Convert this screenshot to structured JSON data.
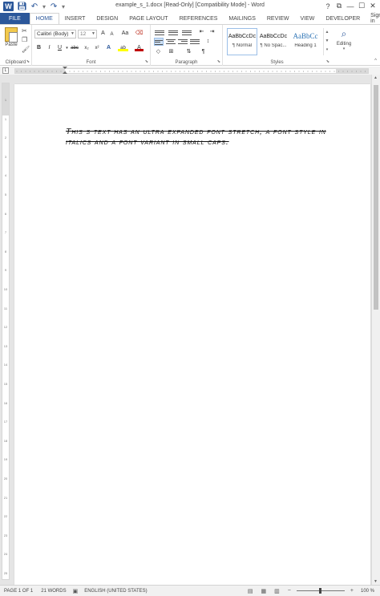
{
  "title": "example_s_1.docx [Read-Only] [Compatibility Mode] - Word",
  "qat": {
    "app_icon": "W",
    "icons": [
      "save-icon",
      "undo-icon",
      "redo-icon",
      "customize-icon"
    ]
  },
  "window_controls": [
    "?",
    "⧉",
    "—",
    "☐",
    "✕"
  ],
  "tabs": [
    "FILE",
    "HOME",
    "INSERT",
    "DESIGN",
    "PAGE LAYOUT",
    "REFERENCES",
    "MAILINGS",
    "REVIEW",
    "VIEW",
    "DEVELOPER"
  ],
  "active_tab": "HOME",
  "signin": "Sign in",
  "ribbon": {
    "clipboard": {
      "label": "Clipboard",
      "paste": "Paste"
    },
    "font": {
      "label": "Font",
      "name": "Calibri (Body)",
      "size": "12",
      "grow": "A",
      "shrink": "A",
      "case": "Aa",
      "bold": "B",
      "italic": "I",
      "underline": "U",
      "strike": "abc",
      "sub": "x₂",
      "sup": "x²",
      "effects": "A",
      "highlight": "ab",
      "color": "A"
    },
    "paragraph": {
      "label": "Paragraph",
      "pilcrow": "¶"
    },
    "styles": {
      "label": "Styles",
      "items": [
        {
          "preview": "AaBbCcDc",
          "name": "¶ Normal"
        },
        {
          "preview": "AaBbCcDc",
          "name": "¶ No Spac..."
        },
        {
          "preview": "AaBbCc",
          "name": "Heading 1"
        }
      ]
    },
    "editing": {
      "label": "Editing"
    }
  },
  "ruler": {
    "tab_selector": "L"
  },
  "vruler_ticks": [
    "1",
    "1",
    "2",
    "3",
    "4",
    "5",
    "6",
    "7",
    "8",
    "9",
    "10",
    "11",
    "12",
    "13",
    "14",
    "15",
    "16",
    "17",
    "18",
    "19",
    "20",
    "21",
    "22",
    "23",
    "24",
    "25"
  ],
  "document": {
    "text": "This s text has an ultra expanded font stretch, a font style in italics and a font variant in small caps."
  },
  "status": {
    "page": "PAGE 1 OF 1",
    "words": "21 WORDS",
    "language": "ENGLISH (UNITED STATES)",
    "zoom": "100 %",
    "zoom_minus": "−",
    "zoom_plus": "+"
  },
  "colors": {
    "accent": "#2b579a",
    "workspace": "#e5e5e5",
    "font_color_red": "#c00000",
    "highlight_yellow": "#ffff00"
  }
}
